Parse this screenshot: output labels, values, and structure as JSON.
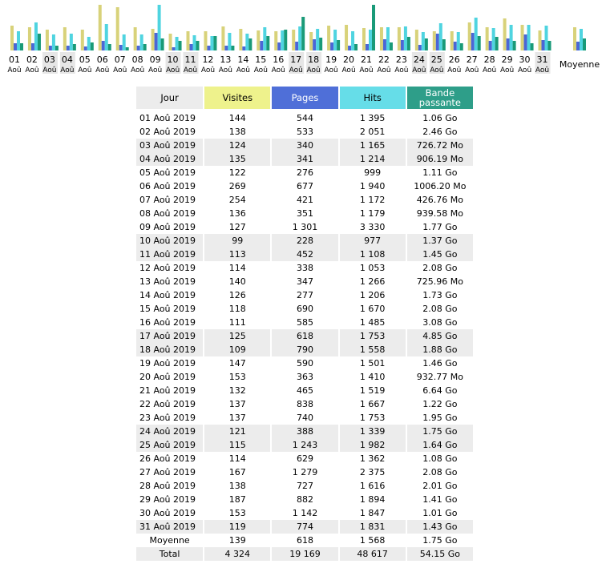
{
  "chart_data": {
    "type": "bar",
    "series": [
      {
        "key": "visits",
        "color": "#d8d27a"
      },
      {
        "key": "pages",
        "color": "#4b66d6"
      },
      {
        "key": "hits",
        "color": "#4fd4e0"
      },
      {
        "key": "bandwidth",
        "color": "#199a78"
      }
    ],
    "categories": [
      {
        "day": "01",
        "month": "Aoû",
        "weekend": false
      },
      {
        "day": "02",
        "month": "Aoû",
        "weekend": false
      },
      {
        "day": "03",
        "month": "Aoû",
        "weekend": true
      },
      {
        "day": "04",
        "month": "Aoû",
        "weekend": true
      },
      {
        "day": "05",
        "month": "Aoû",
        "weekend": false
      },
      {
        "day": "06",
        "month": "Aoû",
        "weekend": false
      },
      {
        "day": "07",
        "month": "Aoû",
        "weekend": false
      },
      {
        "day": "08",
        "month": "Aoû",
        "weekend": false
      },
      {
        "day": "09",
        "month": "Aoû",
        "weekend": false
      },
      {
        "day": "10",
        "month": "Aoû",
        "weekend": true
      },
      {
        "day": "11",
        "month": "Aoû",
        "weekend": true
      },
      {
        "day": "12",
        "month": "Aoû",
        "weekend": false
      },
      {
        "day": "13",
        "month": "Aoû",
        "weekend": false
      },
      {
        "day": "14",
        "month": "Aoû",
        "weekend": false
      },
      {
        "day": "15",
        "month": "Aoû",
        "weekend": false
      },
      {
        "day": "16",
        "month": "Aoû",
        "weekend": false
      },
      {
        "day": "17",
        "month": "Aoû",
        "weekend": true
      },
      {
        "day": "18",
        "month": "Aoû",
        "weekend": true
      },
      {
        "day": "19",
        "month": "Aoû",
        "weekend": false
      },
      {
        "day": "20",
        "month": "Aoû",
        "weekend": false
      },
      {
        "day": "21",
        "month": "Aoû",
        "weekend": false
      },
      {
        "day": "22",
        "month": "Aoû",
        "weekend": false
      },
      {
        "day": "23",
        "month": "Aoû",
        "weekend": false
      },
      {
        "day": "24",
        "month": "Aoû",
        "weekend": true
      },
      {
        "day": "25",
        "month": "Aoû",
        "weekend": true
      },
      {
        "day": "26",
        "month": "Aoû",
        "weekend": false
      },
      {
        "day": "27",
        "month": "Aoû",
        "weekend": false
      },
      {
        "day": "28",
        "month": "Aoû",
        "weekend": false
      },
      {
        "day": "29",
        "month": "Aoû",
        "weekend": false
      },
      {
        "day": "30",
        "month": "Aoû",
        "weekend": false
      },
      {
        "day": "31",
        "month": "Aoû",
        "weekend": true
      }
    ],
    "visits": [
      144,
      138,
      124,
      135,
      122,
      269,
      254,
      136,
      127,
      99,
      113,
      114,
      140,
      126,
      118,
      111,
      125,
      109,
      147,
      153,
      132,
      137,
      137,
      121,
      115,
      114,
      167,
      138,
      187,
      153,
      119
    ],
    "pages": [
      544,
      533,
      340,
      341,
      276,
      677,
      421,
      351,
      1301,
      228,
      452,
      338,
      347,
      277,
      690,
      585,
      618,
      790,
      590,
      363,
      465,
      838,
      740,
      388,
      1243,
      629,
      1279,
      727,
      882,
      1142,
      774
    ],
    "hits": [
      1395,
      2051,
      1165,
      1214,
      999,
      1940,
      1172,
      1179,
      3330,
      977,
      1108,
      1053,
      1266,
      1206,
      1670,
      1485,
      1753,
      1558,
      1501,
      1410,
      1519,
      1667,
      1753,
      1339,
      1982,
      1362,
      2375,
      1616,
      1894,
      1847,
      1831
    ],
    "bandwidth_go": [
      1.06,
      2.46,
      0.71,
      0.89,
      1.11,
      0.98,
      0.42,
      0.92,
      1.77,
      1.37,
      1.45,
      2.08,
      0.71,
      1.73,
      2.08,
      3.08,
      4.85,
      1.88,
      1.46,
      0.91,
      6.64,
      1.22,
      1.95,
      1.75,
      1.64,
      1.08,
      2.08,
      2.01,
      1.41,
      1.01,
      1.43
    ],
    "average": {
      "label": "Moyenne",
      "visits": 139,
      "pages": 618,
      "hits": 1568,
      "bandwidth_go": 1.75
    }
  },
  "table": {
    "headers": {
      "jour": "Jour",
      "visites": "Visites",
      "pages": "Pages",
      "hits": "Hits",
      "bande": "Bande passante"
    },
    "rows": [
      {
        "date": "01 Aoû 2019",
        "visites": "144",
        "pages": "544",
        "hits": "1 395",
        "bande": "1.06 Go",
        "we": false
      },
      {
        "date": "02 Aoû 2019",
        "visites": "138",
        "pages": "533",
        "hits": "2 051",
        "bande": "2.46 Go",
        "we": false
      },
      {
        "date": "03 Aoû 2019",
        "visites": "124",
        "pages": "340",
        "hits": "1 165",
        "bande": "726.72 Mo",
        "we": true
      },
      {
        "date": "04 Aoû 2019",
        "visites": "135",
        "pages": "341",
        "hits": "1 214",
        "bande": "906.19 Mo",
        "we": true
      },
      {
        "date": "05 Aoû 2019",
        "visites": "122",
        "pages": "276",
        "hits": "999",
        "bande": "1.11 Go",
        "we": false
      },
      {
        "date": "06 Aoû 2019",
        "visites": "269",
        "pages": "677",
        "hits": "1 940",
        "bande": "1006.20 Mo",
        "we": false
      },
      {
        "date": "07 Aoû 2019",
        "visites": "254",
        "pages": "421",
        "hits": "1 172",
        "bande": "426.76 Mo",
        "we": false
      },
      {
        "date": "08 Aoû 2019",
        "visites": "136",
        "pages": "351",
        "hits": "1 179",
        "bande": "939.58 Mo",
        "we": false
      },
      {
        "date": "09 Aoû 2019",
        "visites": "127",
        "pages": "1 301",
        "hits": "3 330",
        "bande": "1.77 Go",
        "we": false
      },
      {
        "date": "10 Aoû 2019",
        "visites": "99",
        "pages": "228",
        "hits": "977",
        "bande": "1.37 Go",
        "we": true
      },
      {
        "date": "11 Aoû 2019",
        "visites": "113",
        "pages": "452",
        "hits": "1 108",
        "bande": "1.45 Go",
        "we": true
      },
      {
        "date": "12 Aoû 2019",
        "visites": "114",
        "pages": "338",
        "hits": "1 053",
        "bande": "2.08 Go",
        "we": false
      },
      {
        "date": "13 Aoû 2019",
        "visites": "140",
        "pages": "347",
        "hits": "1 266",
        "bande": "725.96 Mo",
        "we": false
      },
      {
        "date": "14 Aoû 2019",
        "visites": "126",
        "pages": "277",
        "hits": "1 206",
        "bande": "1.73 Go",
        "we": false
      },
      {
        "date": "15 Aoû 2019",
        "visites": "118",
        "pages": "690",
        "hits": "1 670",
        "bande": "2.08 Go",
        "we": false
      },
      {
        "date": "16 Aoû 2019",
        "visites": "111",
        "pages": "585",
        "hits": "1 485",
        "bande": "3.08 Go",
        "we": false
      },
      {
        "date": "17 Aoû 2019",
        "visites": "125",
        "pages": "618",
        "hits": "1 753",
        "bande": "4.85 Go",
        "we": true
      },
      {
        "date": "18 Aoû 2019",
        "visites": "109",
        "pages": "790",
        "hits": "1 558",
        "bande": "1.88 Go",
        "we": true
      },
      {
        "date": "19 Aoû 2019",
        "visites": "147",
        "pages": "590",
        "hits": "1 501",
        "bande": "1.46 Go",
        "we": false
      },
      {
        "date": "20 Aoû 2019",
        "visites": "153",
        "pages": "363",
        "hits": "1 410",
        "bande": "932.77 Mo",
        "we": false
      },
      {
        "date": "21 Aoû 2019",
        "visites": "132",
        "pages": "465",
        "hits": "1 519",
        "bande": "6.64 Go",
        "we": false
      },
      {
        "date": "22 Aoû 2019",
        "visites": "137",
        "pages": "838",
        "hits": "1 667",
        "bande": "1.22 Go",
        "we": false
      },
      {
        "date": "23 Aoû 2019",
        "visites": "137",
        "pages": "740",
        "hits": "1 753",
        "bande": "1.95 Go",
        "we": false
      },
      {
        "date": "24 Aoû 2019",
        "visites": "121",
        "pages": "388",
        "hits": "1 339",
        "bande": "1.75 Go",
        "we": true
      },
      {
        "date": "25 Aoû 2019",
        "visites": "115",
        "pages": "1 243",
        "hits": "1 982",
        "bande": "1.64 Go",
        "we": true
      },
      {
        "date": "26 Aoû 2019",
        "visites": "114",
        "pages": "629",
        "hits": "1 362",
        "bande": "1.08 Go",
        "we": false
      },
      {
        "date": "27 Aoû 2019",
        "visites": "167",
        "pages": "1 279",
        "hits": "2 375",
        "bande": "2.08 Go",
        "we": false
      },
      {
        "date": "28 Aoû 2019",
        "visites": "138",
        "pages": "727",
        "hits": "1 616",
        "bande": "2.01 Go",
        "we": false
      },
      {
        "date": "29 Aoû 2019",
        "visites": "187",
        "pages": "882",
        "hits": "1 894",
        "bande": "1.41 Go",
        "we": false
      },
      {
        "date": "30 Aoû 2019",
        "visites": "153",
        "pages": "1 142",
        "hits": "1 847",
        "bande": "1.01 Go",
        "we": false
      },
      {
        "date": "31 Aoû 2019",
        "visites": "119",
        "pages": "774",
        "hits": "1 831",
        "bande": "1.43 Go",
        "we": true
      }
    ],
    "average": {
      "label": "Moyenne",
      "visites": "139",
      "pages": "618",
      "hits": "1 568",
      "bande": "1.75 Go"
    },
    "total": {
      "label": "Total",
      "visites": "4 324",
      "pages": "19 169",
      "hits": "48 617",
      "bande": "54.15 Go"
    }
  }
}
